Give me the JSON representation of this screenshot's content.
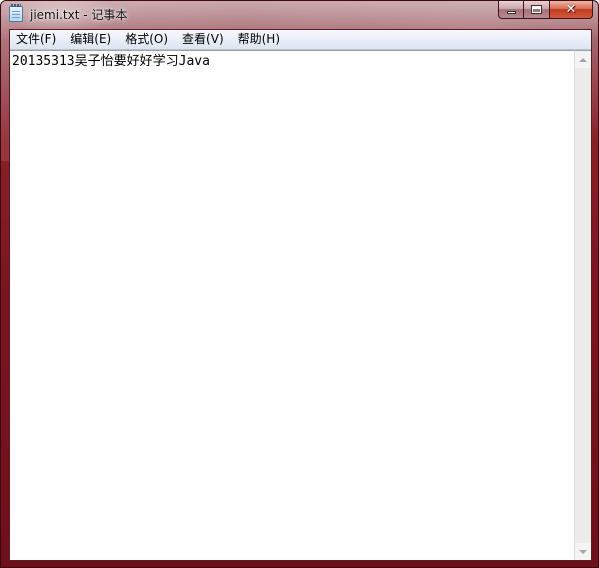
{
  "window": {
    "title": "jiemi.txt - 记事本",
    "frame_color": "#7b1420",
    "icon": "notepad-icon"
  },
  "controls": {
    "minimize_icon": "minimize-icon",
    "maximize_icon": "maximize-icon",
    "close_label": "✕"
  },
  "menu": {
    "items": [
      {
        "label": "文件(F)"
      },
      {
        "label": "编辑(E)"
      },
      {
        "label": "格式(O)"
      },
      {
        "label": "查看(V)"
      },
      {
        "label": "帮助(H)"
      }
    ]
  },
  "editor": {
    "content": "20135313吴子怡要好好学习Java"
  },
  "scrollbar": {
    "up_icon": "scroll-up-arrow-icon",
    "down_icon": "scroll-down-arrow-icon"
  }
}
